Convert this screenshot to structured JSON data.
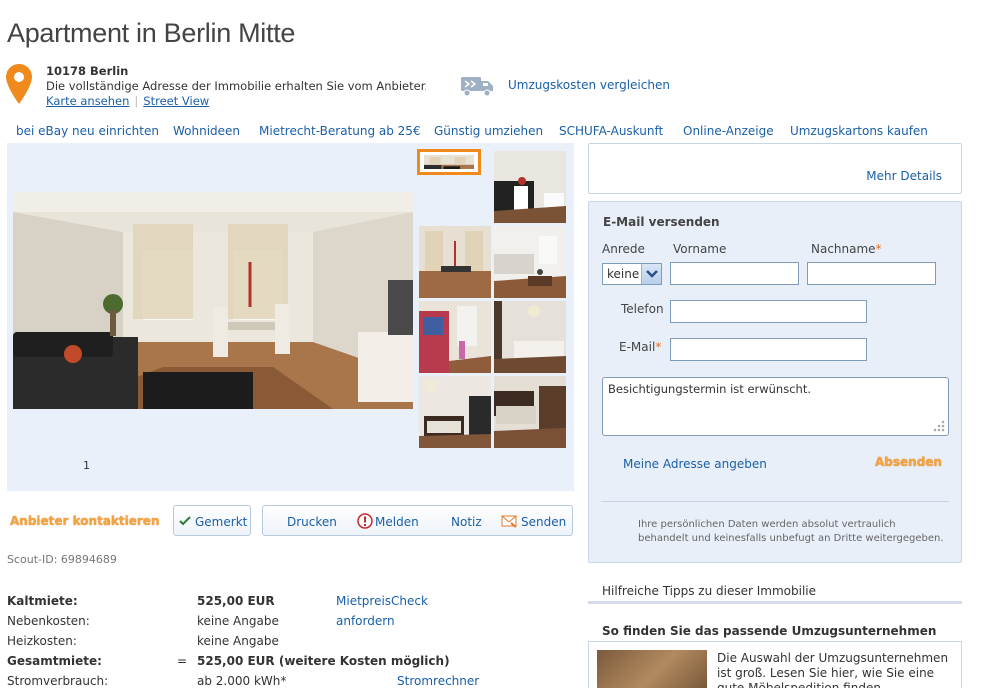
{
  "header": {
    "title": "Apartment in Berlin Mitte",
    "zip_city": "10178 Berlin",
    "address_note": "Die vollständige Adresse der Immobilie erhalten Sie vom Anbieter.",
    "map_link": "Karte ansehen",
    "street_view_link": "Street View",
    "umzug_link": "Umzugskosten vergleichen"
  },
  "topnav": [
    "bei eBay neu einrichten",
    "Wohnideen",
    "Mietrecht-Beratung ab 25€",
    "Günstig umziehen",
    "SCHUFA-Auskunft",
    "Online-Anzeige",
    "Umzugskartons kaufen"
  ],
  "gallery": {
    "counter": "1"
  },
  "actions": {
    "kontakt": "Anbieter kontaktieren",
    "gemerkt": "Gemerkt",
    "drucken": "Drucken",
    "melden": "Melden",
    "notiz": "Notiz",
    "senden": "Senden"
  },
  "scout_id": "Scout-ID: 69894689",
  "costs": {
    "kaltmiete_label": "Kaltmiete:",
    "kaltmiete_value": "525,00 EUR",
    "mietpreis_link": "MietpreisCheck anfordern",
    "neben_label": "Nebenkosten:",
    "neben_value": "keine Angabe",
    "heiz_label": "Heizkosten:",
    "heiz_value": "keine Angabe",
    "gesamt_label": "Gesamtmiete:",
    "gesamt_eq": "=",
    "gesamt_value": "525,00 EUR (weitere Kosten möglich)",
    "strom_label": "Stromverbrauch:",
    "strom_value": "ab 2.000 kWh*",
    "strom_link": "Stromrechner"
  },
  "right": {
    "mehr_details": "Mehr Details",
    "form_title": "E-Mail versenden",
    "anrede_label": "Anrede",
    "anrede_value": "keine",
    "vorname_label": "Vorname",
    "nachname_label": "Nachname",
    "telefon_label": "Telefon",
    "email_label": "E-Mail",
    "required_mark": "*",
    "message": "Besichtigungstermin ist erwünscht.",
    "adresse_link": "Meine Adresse angeben",
    "absenden": "Absenden",
    "privacy": "Ihre persönlichen Daten werden absolut vertraulich behandelt und keinesfalls unbefugt an Dritte weitergegeben.",
    "tipps": "Hilfreiche Tipps zu dieser Immobilie",
    "umzug_heading": "So finden Sie das passende Umzugsunternehmen",
    "umzug_text": "Die Auswahl der Umzugsunternehmen ist groß. Lesen Sie hier, wie Sie eine gute Möbelspedition finden."
  },
  "colors": {
    "link": "#1a5fa8",
    "accent_orange": "#f7a33b",
    "panel_bg": "#e8eff8"
  }
}
